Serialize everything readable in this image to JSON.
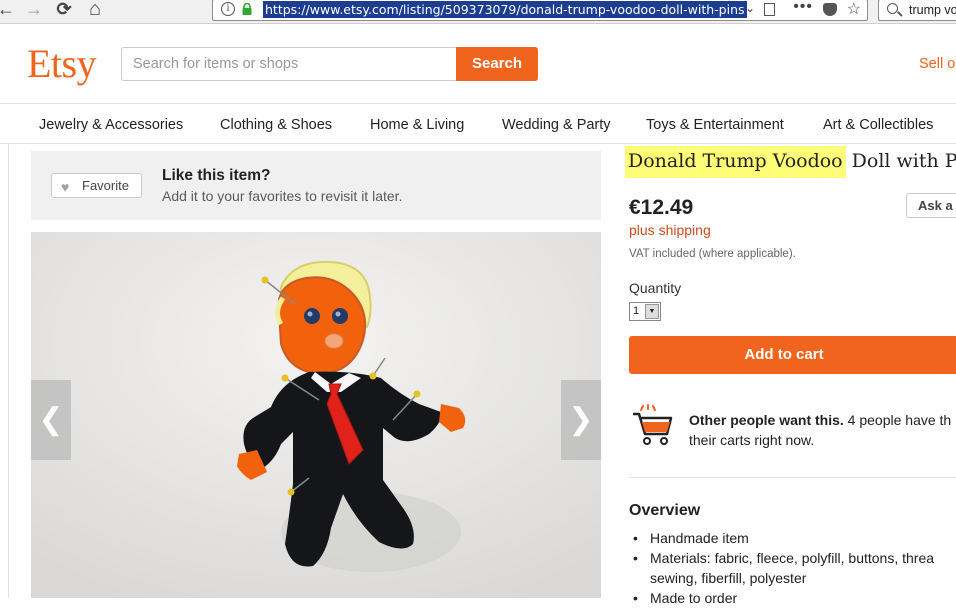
{
  "browser": {
    "back_icon": "←",
    "forward_icon": "→",
    "reload_icon": "⟳",
    "home_icon": "⌂",
    "url": "https://www.etsy.com/listing/509373079/donald-trump-voodoo-doll-with-pins",
    "dropdown_icon": "⌄",
    "more_icon": "•••",
    "star_icon": "☆",
    "search_text": "trump vo"
  },
  "header": {
    "logo": "Etsy",
    "search_placeholder": "Search for items or shops",
    "search_button": "Search",
    "sell_link": "Sell o"
  },
  "categories": [
    "Jewelry & Accessories",
    "Clothing & Shoes",
    "Home & Living",
    "Wedding & Party",
    "Toys & Entertainment",
    "Art & Collectibles"
  ],
  "favorite": {
    "button": "Favorite",
    "heart_icon": "♥",
    "title": "Like this item?",
    "subtitle": "Add it to your favorites to revisit it later."
  },
  "gallery": {
    "prev_icon": "❮",
    "next_icon": "❯"
  },
  "listing": {
    "title_highlight": "Donald Trump Voodoo",
    "title_rest": " Doll with Pins",
    "price": "€12.49",
    "shipping": "plus shipping",
    "vat": "VAT included (where applicable).",
    "ask_button": "Ask a q",
    "quantity_label": "Quantity",
    "quantity_value": "1",
    "quantity_arrow": "▼",
    "add_to_cart": "Add to cart",
    "want_bold": "Other people want this.",
    "want_rest": " 4 people have th",
    "want_line2": "their carts right now."
  },
  "overview": {
    "title": "Overview",
    "items": [
      "Handmade item",
      "Materials: fabric, fleece, polyfill, buttons, threa",
      "sewing, fiberfill, polyester",
      "Made to order"
    ]
  },
  "colors": {
    "brand_orange": "#f1641e",
    "highlight_yellow": "#fdfd78",
    "shipping_red": "#d0491c"
  }
}
